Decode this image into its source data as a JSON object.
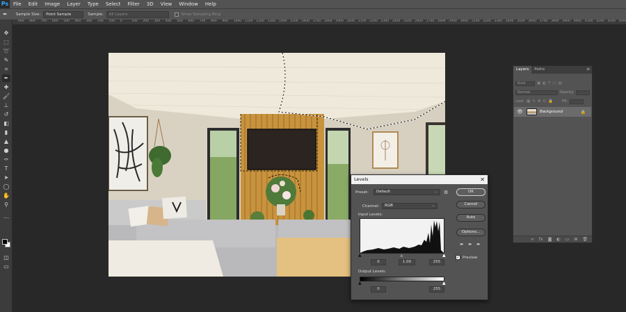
{
  "app": {
    "logo": "Ps"
  },
  "menu": [
    "File",
    "Edit",
    "Image",
    "Layer",
    "Type",
    "Select",
    "Filter",
    "3D",
    "View",
    "Window",
    "Help"
  ],
  "options_bar": {
    "sample_size_label": "Sample Size:",
    "sample_size_value": "Point Sample",
    "sample_label": "Sample:",
    "sample_value": "All Layers",
    "show_ring_label": "Show Sampling Ring"
  },
  "ruler_ticks": [
    "900",
    "800",
    "700",
    "600",
    "500",
    "400",
    "300",
    "200",
    "100",
    "0",
    "100",
    "200",
    "300",
    "400",
    "500",
    "600",
    "700",
    "800",
    "900",
    "1000",
    "1100",
    "1200",
    "1300",
    "1400",
    "1500",
    "1600",
    "1700",
    "1800",
    "1900",
    "2000",
    "2100",
    "2200",
    "2300",
    "2400",
    "2500",
    "2600",
    "2700",
    "2800",
    "2900",
    "3000",
    "3100",
    "3200",
    "3300",
    "3400",
    "3500",
    "3600",
    "3700",
    "3800",
    "3900",
    "4000",
    "4100",
    "4200",
    "4300",
    "4400"
  ],
  "layers_panel": {
    "tabs": [
      "Layers",
      "Paths"
    ],
    "kind_placeholder": "Kind",
    "blend_mode": "Normal",
    "opacity_label": "Opacity:",
    "lock_label": "Lock:",
    "fill_label": "Fill:",
    "layer_name": "Background"
  },
  "levels": {
    "title": "Levels",
    "preset_label": "Preset:",
    "preset_value": "Default",
    "channel_label": "Channel:",
    "channel_value": "RGB",
    "input_levels_label": "Input Levels:",
    "input_black": "0",
    "input_gamma": "1.00",
    "input_white": "255",
    "output_levels_label": "Output Levels:",
    "output_black": "0",
    "output_white": "255",
    "buttons": {
      "ok": "OK",
      "cancel": "Cancel",
      "auto": "Auto",
      "options": "Options..."
    },
    "preview_label": "Preview",
    "preview_checked": true
  }
}
